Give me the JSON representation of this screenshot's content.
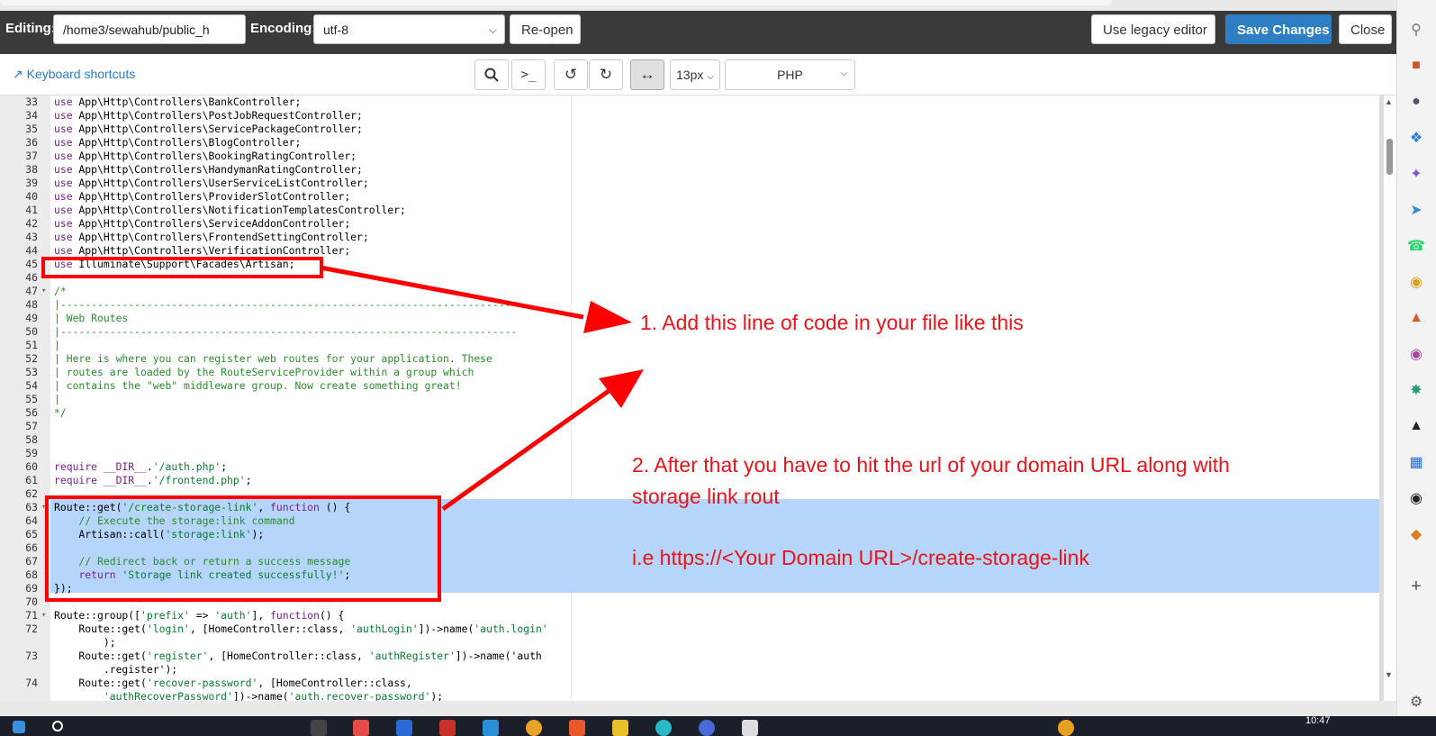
{
  "header": {
    "editing_label": "Editing:",
    "file_path": "/home3/sewahub/public_h",
    "encoding_label": "Encoding:",
    "encoding_value": "utf-8",
    "reopen_label": "Re-open",
    "legacy_label": "Use legacy editor",
    "save_label": "Save Changes",
    "close_label": "Close"
  },
  "toolbar": {
    "shortcuts_label": "Keyboard shortcuts",
    "font_size": "13px",
    "mode": "PHP",
    "icons": [
      "search-icon",
      "terminal-icon",
      "undo-icon",
      "redo-icon",
      "wrap-icon"
    ]
  },
  "code": [
    {
      "n": "33",
      "t": "use App\\Http\\Controllers\\BankController;"
    },
    {
      "n": "34",
      "t": "use App\\Http\\Controllers\\PostJobRequestController;"
    },
    {
      "n": "35",
      "t": "use App\\Http\\Controllers\\ServicePackageController;"
    },
    {
      "n": "36",
      "t": "use App\\Http\\Controllers\\BlogController;"
    },
    {
      "n": "37",
      "t": "use App\\Http\\Controllers\\BookingRatingController;"
    },
    {
      "n": "38",
      "t": "use App\\Http\\Controllers\\HandymanRatingController;"
    },
    {
      "n": "39",
      "t": "use App\\Http\\Controllers\\UserServiceListController;"
    },
    {
      "n": "40",
      "t": "use App\\Http\\Controllers\\ProviderSlotController;"
    },
    {
      "n": "41",
      "t": "use App\\Http\\Controllers\\NotificationTemplatesController;"
    },
    {
      "n": "42",
      "t": "use App\\Http\\Controllers\\ServiceAddonController;"
    },
    {
      "n": "43",
      "t": "use App\\Http\\Controllers\\FrontendSettingController;"
    },
    {
      "n": "44",
      "t": "use App\\Http\\Controllers\\VerificationController;"
    },
    {
      "n": "45",
      "t": "use Illuminate\\Support\\Facades\\Artisan;"
    },
    {
      "n": "46",
      "t": ""
    },
    {
      "n": "47",
      "t": "/*",
      "fold": true
    },
    {
      "n": "48",
      "t": "|--------------------------------------------------------------------------"
    },
    {
      "n": "49",
      "t": "| Web Routes"
    },
    {
      "n": "50",
      "t": "|--------------------------------------------------------------------------"
    },
    {
      "n": "51",
      "t": "|"
    },
    {
      "n": "52",
      "t": "| Here is where you can register web routes for your application. These"
    },
    {
      "n": "53",
      "t": "| routes are loaded by the RouteServiceProvider within a group which"
    },
    {
      "n": "54",
      "t": "| contains the \"web\" middleware group. Now create something great!"
    },
    {
      "n": "55",
      "t": "|"
    },
    {
      "n": "56",
      "t": "*/"
    },
    {
      "n": "57",
      "t": ""
    },
    {
      "n": "58",
      "t": ""
    },
    {
      "n": "59",
      "t": ""
    },
    {
      "n": "60",
      "t": "require __DIR__.'/auth.php';"
    },
    {
      "n": "61",
      "t": "require __DIR__.'/frontend.php';"
    },
    {
      "n": "62",
      "t": ""
    },
    {
      "n": "63",
      "t": "Route::get('/create-storage-link', function () {",
      "fold": true
    },
    {
      "n": "64",
      "t": "    // Execute the storage:link command"
    },
    {
      "n": "65",
      "t": "    Artisan::call('storage:link');"
    },
    {
      "n": "66",
      "t": ""
    },
    {
      "n": "67",
      "t": "    // Redirect back or return a success message"
    },
    {
      "n": "68",
      "t": "    return 'Storage link created successfully!';"
    },
    {
      "n": "69",
      "t": "});"
    },
    {
      "n": "70",
      "t": ""
    },
    {
      "n": "71",
      "t": "Route::group(['prefix' => 'auth'], function() {",
      "fold": true
    },
    {
      "n": "72",
      "t": "    Route::get('login', [HomeController::class, 'authLogin'])->name('auth.login'"
    },
    {
      "n": "",
      "t": "        );"
    },
    {
      "n": "73",
      "t": "    Route::get('register', [HomeController::class, 'authRegister'])->name('auth"
    },
    {
      "n": "",
      "t": "        .register');"
    },
    {
      "n": "74",
      "t": "    Route::get('recover-password', [HomeController::class,"
    },
    {
      "n": "",
      "t": "        'authRecoverPassword'])->name('auth.recover-password');"
    }
  ],
  "annotations": {
    "step1": "1. Add this line of code in your file like this",
    "step2_line1": "2. After that you have to hit the url of your domain URL along with",
    "step2_line2": "storage link rout",
    "step2_example": "i.e  https://<Your Domain URL>/create-storage-link"
  },
  "taskbar": {
    "clock": "10:47"
  },
  "colors": {
    "header_bg": "#3a3a3a",
    "primary": "#2d7ec3",
    "selection": "#b5d5fb",
    "annotation": "#ff0000"
  }
}
